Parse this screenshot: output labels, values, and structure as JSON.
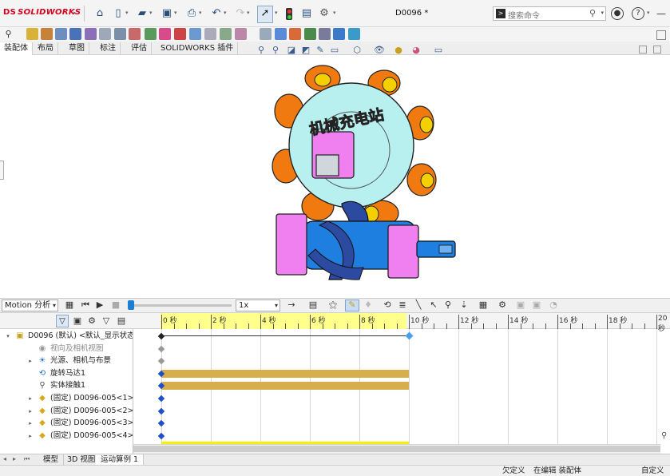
{
  "app": {
    "logo_text": "SOLIDWORKS",
    "logo_mark": "DS",
    "document_title": "D0096 *"
  },
  "search": {
    "placeholder": "搜索命令",
    "cmd_icon": ">"
  },
  "window_controls": {
    "minimize": "—",
    "restore": "❐"
  },
  "help": {
    "user_icon": "person-icon",
    "help_label": "?"
  },
  "command_tabs": [
    {
      "label": "装配体",
      "active": true
    },
    {
      "label": "布局",
      "active": false
    },
    {
      "label": "草图",
      "active": false
    },
    {
      "label": "标注",
      "active": false
    },
    {
      "label": "评估",
      "active": false
    },
    {
      "label": "SOLIDWORKS 插件",
      "active": false
    }
  ],
  "model_text": "机械充电站",
  "colors": {
    "wheel_fill": "#b8f0f0",
    "roller_orange": "#f07a10",
    "roller_yellow": "#f5d000",
    "hub_pink": "#f080f0",
    "shaft_blue": "#1f7fe0",
    "worm_dark": "#2c4aa0",
    "text_red": "#cc1020",
    "key_blue": "#1b7fd6"
  },
  "motion": {
    "study_type": "Motion 分析",
    "speed": "1x"
  },
  "timeline": {
    "ticks": [
      "0 秒",
      "2 秒",
      "4 秒",
      "6 秒",
      "8 秒",
      "10 秒",
      "12 秒",
      "14 秒",
      "16 秒",
      "18 秒",
      "20 秒"
    ],
    "range_seconds": [
      0,
      20
    ],
    "highlight_end_seconds": 10,
    "bars": [
      {
        "row": 3,
        "start": 0,
        "end": 10
      },
      {
        "row": 4,
        "start": 0,
        "end": 10
      }
    ]
  },
  "tree": [
    {
      "label": "D0096 (默认) <默认_显示状态",
      "icon": "assembly-icon",
      "twist": "▾",
      "indent": 0,
      "grey": false
    },
    {
      "label": "视向及相机视图",
      "icon": "camera-icon",
      "twist": "",
      "indent": 1,
      "grey": true
    },
    {
      "label": "光源、相机与布景",
      "icon": "light-icon",
      "twist": "▸",
      "indent": 1,
      "grey": false
    },
    {
      "label": "旋转马达1",
      "icon": "motor-icon",
      "twist": "",
      "indent": 1,
      "grey": false
    },
    {
      "label": "实体接触1",
      "icon": "contact-icon",
      "twist": "",
      "indent": 1,
      "grey": false
    },
    {
      "label": "(固定) D0096-005<1> (默",
      "icon": "part-icon",
      "twist": "▸",
      "indent": 1,
      "grey": false
    },
    {
      "label": "(固定) D0096-005<2> (默",
      "icon": "part-icon",
      "twist": "▸",
      "indent": 1,
      "grey": false
    },
    {
      "label": "(固定) D0096-005<3> (默",
      "icon": "part-icon",
      "twist": "▸",
      "indent": 1,
      "grey": false
    },
    {
      "label": "(固定) D0096-005<4> (默",
      "icon": "part-icon",
      "twist": "▸",
      "indent": 1,
      "grey": false
    }
  ],
  "bottom_tabs": [
    {
      "label": "模型",
      "active": false
    },
    {
      "label": "3D 视图",
      "active": false
    },
    {
      "label": "运动算例 1",
      "active": true
    }
  ],
  "status": {
    "underdefined": "欠定义",
    "editing": "在编辑 装配体",
    "custom": "自定义"
  }
}
